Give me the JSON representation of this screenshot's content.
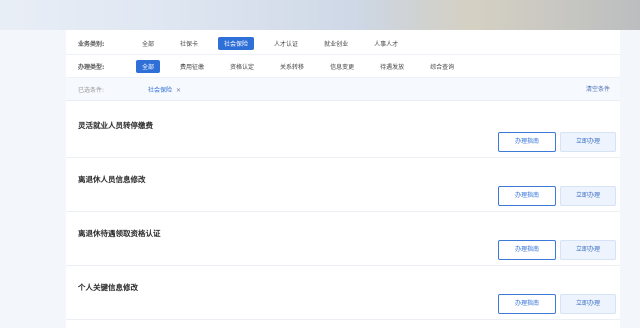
{
  "filters": {
    "business_type_label": "业务类别:",
    "business_types": [
      "全部",
      "社保卡",
      "社会保险",
      "人才认证",
      "就业创业",
      "人事人才"
    ],
    "business_type_selected": "社会保险",
    "handling_type_label": "办理类型:",
    "handling_types": [
      "全部",
      "费用征缴",
      "资格认定",
      "关系转移",
      "信息变更",
      "待遇发放",
      "综合查询"
    ],
    "handling_type_selected": "全部",
    "selected_label": "已选条件:",
    "selected_tag": "社会保险",
    "clear_label": "清空条件"
  },
  "items": [
    {
      "title": "灵活就业人员转停缴费",
      "guide_label": "办理指南",
      "apply_label": "立即办理"
    },
    {
      "title": "离退休人员信息修改",
      "guide_label": "办理指南",
      "apply_label": "立即办理"
    },
    {
      "title": "离退休待遇领取资格认证",
      "guide_label": "办理指南",
      "apply_label": "立即办理"
    },
    {
      "title": "个人关键信息修改",
      "guide_label": "办理指南",
      "apply_label": "立即办理"
    }
  ],
  "colors": {
    "accent": "#2f6fd8"
  }
}
